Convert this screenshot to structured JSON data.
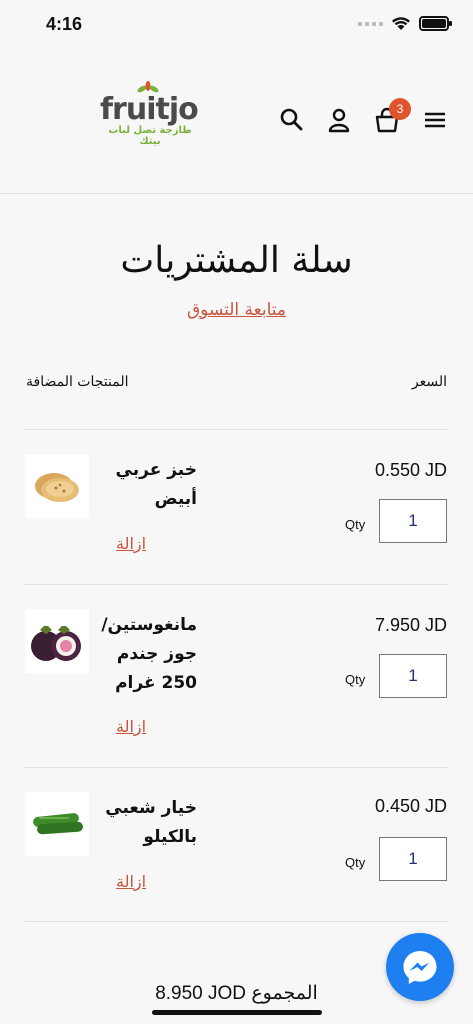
{
  "status": {
    "time": "4:16"
  },
  "header": {
    "logo_text": "fruitjo",
    "logo_tagline": "طازجة تصل لباب بيتك",
    "cart_count": "3"
  },
  "page": {
    "title": "سلة المشتريات",
    "continue_shopping": "متابعة التسوق",
    "col_products": "المنتجات المضافة",
    "col_price": "السعر"
  },
  "items": [
    {
      "name": "خبز عربي أبيض",
      "price": "0.550 JD",
      "qty_label": "Qty",
      "qty": "1",
      "remove": "ازالة",
      "icon": "bread-icon"
    },
    {
      "name": "مانغوستين/ جوز جندم 250 غرام",
      "price": "7.950 JD",
      "qty_label": "Qty",
      "qty": "1",
      "remove": "ازالة",
      "icon": "mangosteen-icon"
    },
    {
      "name": "خيار شعبي بالكيلو",
      "price": "0.450 JD",
      "qty_label": "Qty",
      "qty": "1",
      "remove": "ازالة",
      "icon": "cucumber-icon"
    }
  ],
  "total": "8.950 JOD المجموع",
  "colors": {
    "accent": "#c8553d",
    "badge": "#e0542c",
    "messenger": "#1e7ff1",
    "brand_green": "#7db13c"
  }
}
